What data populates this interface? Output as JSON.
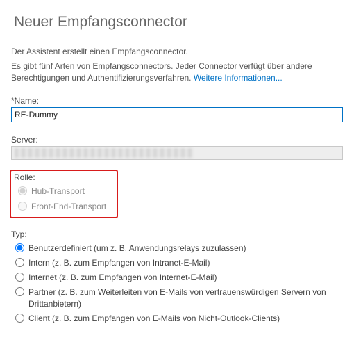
{
  "header": {
    "title": "Neuer Empfangsconnector"
  },
  "intro": {
    "line1": "Der Assistent erstellt einen Empfangsconnector.",
    "line2_prefix": "Es gibt fünf Arten von Empfangsconnectors. Jeder Connector verfügt über andere Berechtigungen und Authentifizierungsverfahren. ",
    "more_info": "Weitere Informationen..."
  },
  "nameField": {
    "label": "*Name:",
    "value": "RE-Dummy"
  },
  "serverField": {
    "label": "Server:"
  },
  "rolle": {
    "label": "Rolle:",
    "options": [
      {
        "label": "Hub-Transport",
        "selected": true
      },
      {
        "label": "Front-End-Transport",
        "selected": false
      }
    ]
  },
  "typ": {
    "label": "Typ:",
    "options": [
      {
        "label": "Benutzerdefiniert (um z. B. Anwendungsrelays zuzulassen)",
        "selected": true
      },
      {
        "label": "Intern (z. B. zum Empfangen von Intranet-E-Mail)",
        "selected": false
      },
      {
        "label": "Internet (z. B. zum Empfangen von Internet-E-Mail)",
        "selected": false
      },
      {
        "label": "Partner (z. B. zum Weiterleiten von E-Mails von vertrauenswürdigen Servern von Drittanbietern)",
        "selected": false
      },
      {
        "label": "Client (z. B. zum Empfangen von E-Mails von Nicht-Outlook-Clients)",
        "selected": false
      }
    ]
  }
}
